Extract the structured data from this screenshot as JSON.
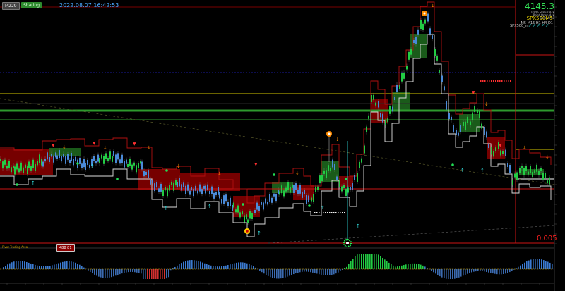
{
  "header": {
    "symbol_badge": "M229",
    "green_badge": "Sharing",
    "timestamp": "2022.08.07 16:42:53"
  },
  "info_panel": {
    "price": "4145.3",
    "line2": "Trade Status Ask",
    "line3": "Point Open Ask",
    "line4": "Spread 50",
    "instrument": "SPX500M5",
    "timeframes": "M5 M15 H1 H4 D1",
    "symbol_row": "SPX500_m"
  },
  "footer": {
    "indicator_label": "Pivot Trading Area",
    "red_box_value": "488 81",
    "spread_value": "0.005"
  },
  "colors": {
    "bg": "#000000",
    "bull": "#22cc44",
    "bear": "#4a8ad8",
    "zone_red": "#8b0000",
    "zone_green": "#1e6b1e",
    "level_yellow": "#d4c600",
    "level_green": "#2e9a2e",
    "level_red": "#cc1414",
    "accent_cyan": "#33e0e0",
    "accent_orange": "#ff8c00"
  },
  "icons": {
    "top_marker": "orange-circle-icon",
    "mid_marker": "orange-circle-icon",
    "bottom_marker": "green-gear-icon"
  }
}
